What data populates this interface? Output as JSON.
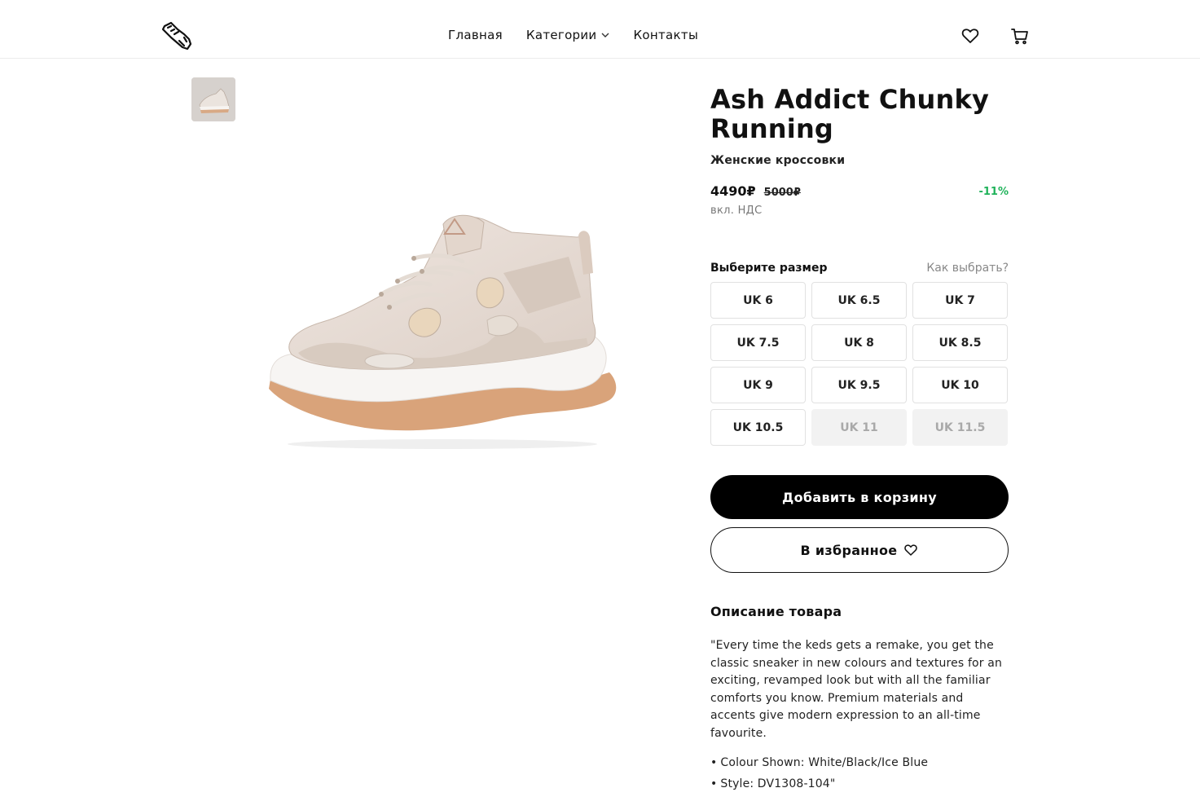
{
  "header": {
    "logo_icon": "sneaker-logo-icon",
    "nav": [
      {
        "label": "Главная"
      },
      {
        "label": "Категории"
      },
      {
        "label": "Контакты"
      }
    ],
    "favorites_icon": "heart-icon",
    "cart_icon": "cart-icon"
  },
  "product": {
    "title": "Ash Addict Chunky Running",
    "subtitle": "Женские кроссовки",
    "price": "4490₽",
    "old_price": "5000₽",
    "discount": "-11%",
    "vat": "вкл. НДС",
    "size_label": "Выберите размер",
    "size_guide": "Как выбрать?",
    "sizes": [
      {
        "label": "UK 6"
      },
      {
        "label": "UK 6.5"
      },
      {
        "label": "UK 7"
      },
      {
        "label": "UK 7.5"
      },
      {
        "label": "UK 8"
      },
      {
        "label": "UK 8.5"
      },
      {
        "label": "UK 9"
      },
      {
        "label": "UK 9.5"
      },
      {
        "label": "UK 10"
      },
      {
        "label": "UK 10.5"
      },
      {
        "label": "UK 11"
      },
      {
        "label": "UK 11.5"
      }
    ],
    "add_to_cart": "Добавить в корзину",
    "add_to_favorites": "В избранное",
    "description_title": "Описание товара",
    "description": "\"Every time the keds gets a remake, you get the classic sneaker in new colours and textures for an exciting, revamped look but with all the familiar comforts you know. Premium materials and accents give modern expression to an all-time favourite.",
    "details": [
      "Colour Shown: White/Black/Ice Blue",
      "Style: DV1308-104\""
    ]
  },
  "colors": {
    "discount": "#1fb25a",
    "primary_button": "#000000",
    "disabled_size": "#f2f2f2"
  }
}
